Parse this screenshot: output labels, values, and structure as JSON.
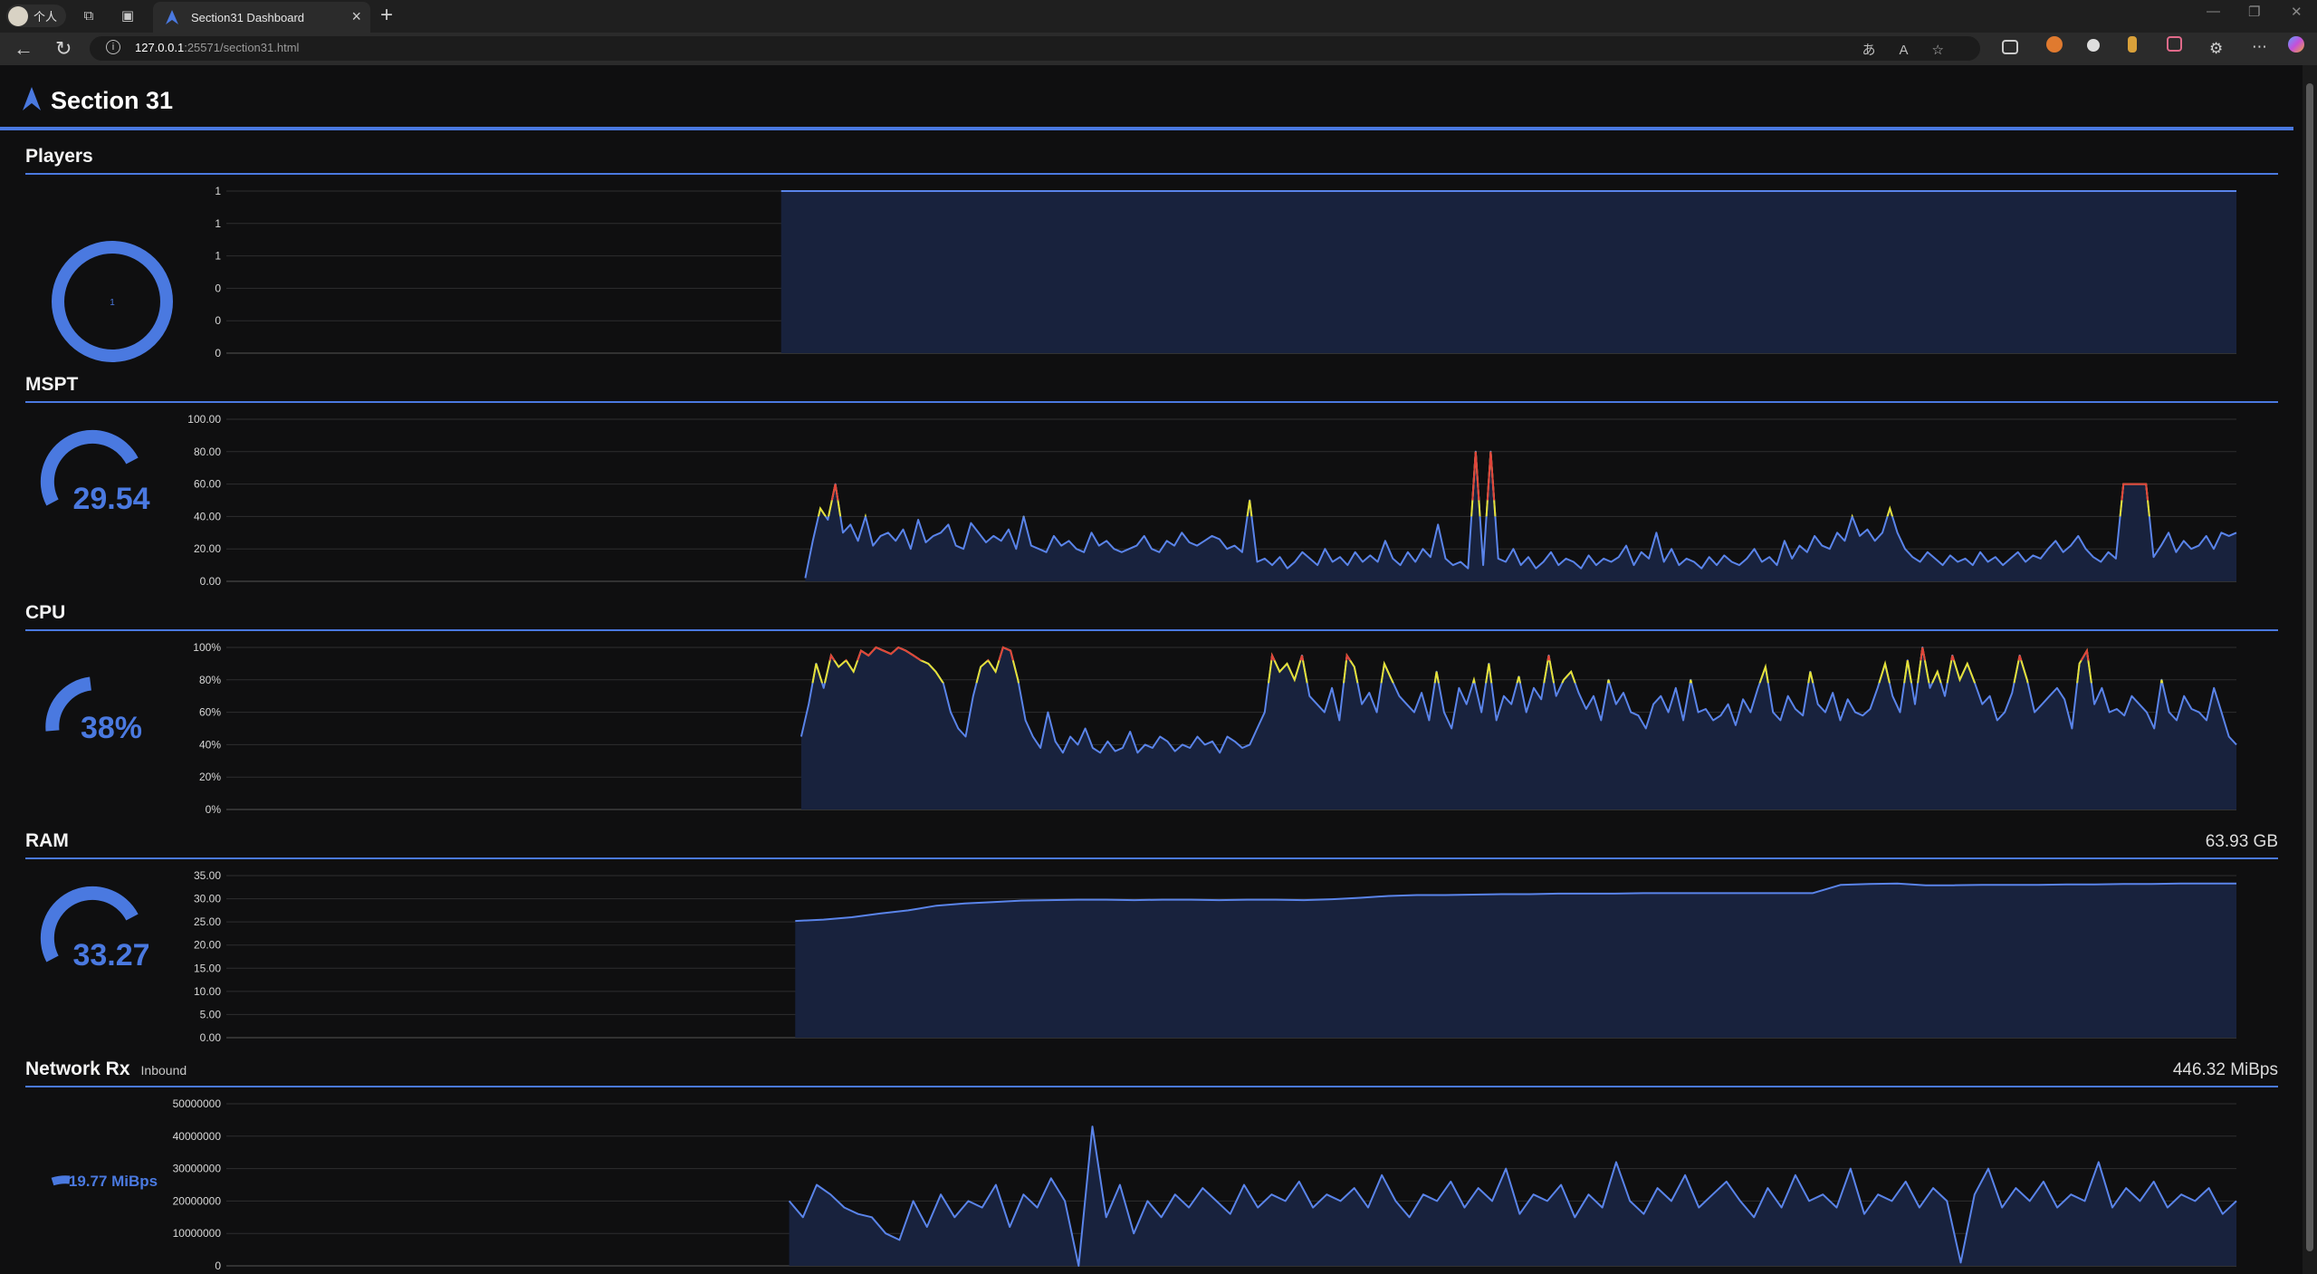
{
  "browser": {
    "profile_label": "个人",
    "tab_title": "Section31 Dashboard",
    "url_host": "127.0.0.1",
    "url_rest": ":25571/section31.html"
  },
  "page": {
    "title": "Section 31"
  },
  "colors": {
    "accent": "#4a79e0",
    "line": "#5a84ea",
    "fill": "#18223d",
    "warn": "#e5e036",
    "crit": "#e0433a"
  },
  "sections": {
    "players": {
      "title": "Players",
      "gauge_value": "1"
    },
    "mspt": {
      "title": "MSPT",
      "gauge_value": "29.54"
    },
    "cpu": {
      "title": "CPU",
      "gauge_value": "38%"
    },
    "ram": {
      "title": "RAM",
      "gauge_value": "33.27",
      "total": "63.93 GB"
    },
    "network": {
      "title": "Network Rx",
      "subtitle": "Inbound",
      "gauge_value": "19.77 MiBps",
      "total": "446.32 MiBps"
    }
  },
  "chart_data": [
    {
      "name": "players",
      "type": "area",
      "yticks": [
        "1",
        "1",
        "1",
        "0",
        "0",
        "0"
      ],
      "ylim": [
        0,
        1
      ],
      "x_start_fraction": 0.276,
      "values": [
        1,
        1,
        1,
        1,
        1,
        1,
        1,
        1,
        1,
        1,
        1,
        1,
        1,
        1,
        1,
        1,
        1,
        1,
        1,
        1
      ]
    },
    {
      "name": "mspt",
      "type": "line",
      "yticks": [
        "100.00",
        "80.00",
        "60.00",
        "40.00",
        "20.00",
        "0.00"
      ],
      "ylim": [
        0,
        100
      ],
      "x_start_fraction": 0.288,
      "warn_threshold": 40,
      "crit_threshold": 50,
      "values": [
        2,
        25,
        45,
        38,
        60,
        30,
        35,
        25,
        40,
        22,
        28,
        30,
        25,
        32,
        20,
        38,
        24,
        28,
        30,
        35,
        22,
        20,
        36,
        30,
        24,
        28,
        25,
        32,
        20,
        40,
        22,
        20,
        18,
        28,
        22,
        25,
        20,
        18,
        30,
        22,
        25,
        20,
        18,
        20,
        22,
        28,
        20,
        18,
        25,
        22,
        30,
        24,
        22,
        25,
        28,
        26,
        20,
        22,
        18,
        50,
        12,
        14,
        10,
        15,
        8,
        12,
        18,
        14,
        10,
        20,
        12,
        15,
        10,
        18,
        12,
        16,
        12,
        25,
        14,
        10,
        18,
        12,
        20,
        15,
        35,
        14,
        10,
        12,
        8,
        80,
        10,
        80,
        14,
        12,
        20,
        10,
        15,
        8,
        12,
        18,
        10,
        14,
        12,
        8,
        16,
        10,
        14,
        12,
        15,
        22,
        10,
        18,
        14,
        30,
        12,
        20,
        10,
        14,
        12,
        8,
        15,
        10,
        16,
        12,
        10,
        14,
        20,
        12,
        15,
        10,
        25,
        14,
        22,
        18,
        28,
        22,
        20,
        30,
        25,
        40,
        28,
        32,
        25,
        30,
        45,
        30,
        20,
        15,
        12,
        18,
        14,
        10,
        16,
        12,
        14,
        10,
        18,
        12,
        15,
        10,
        14,
        18,
        12,
        16,
        14,
        20,
        25,
        18,
        22,
        28,
        20,
        15,
        12,
        18,
        14,
        60,
        60,
        60,
        60,
        15,
        22,
        30,
        18,
        25,
        20,
        22,
        28,
        20,
        30,
        28,
        30
      ]
    },
    {
      "name": "cpu",
      "type": "line",
      "yticks": [
        "100%",
        "80%",
        "60%",
        "40%",
        "20%",
        "0%"
      ],
      "ylim": [
        0,
        100
      ],
      "x_start_fraction": 0.286,
      "warn_threshold": 78,
      "crit_threshold": 92,
      "values": [
        45,
        65,
        90,
        75,
        95,
        88,
        92,
        85,
        98,
        95,
        100,
        98,
        96,
        100,
        98,
        95,
        92,
        90,
        85,
        78,
        60,
        50,
        45,
        70,
        88,
        92,
        85,
        100,
        98,
        80,
        55,
        45,
        38,
        60,
        42,
        35,
        45,
        40,
        50,
        38,
        35,
        42,
        36,
        38,
        48,
        35,
        40,
        38,
        45,
        42,
        36,
        40,
        38,
        45,
        40,
        42,
        35,
        45,
        42,
        38,
        40,
        50,
        60,
        95,
        85,
        90,
        80,
        95,
        70,
        65,
        60,
        75,
        55,
        95,
        88,
        65,
        72,
        60,
        90,
        80,
        70,
        65,
        60,
        72,
        55,
        85,
        60,
        50,
        75,
        65,
        80,
        60,
        90,
        55,
        70,
        65,
        82,
        60,
        75,
        68,
        95,
        70,
        80,
        85,
        72,
        62,
        70,
        55,
        80,
        65,
        72,
        60,
        58,
        50,
        65,
        70,
        60,
        75,
        55,
        80,
        60,
        62,
        55,
        58,
        65,
        52,
        68,
        60,
        75,
        88,
        60,
        55,
        70,
        62,
        58,
        85,
        65,
        60,
        72,
        55,
        68,
        60,
        58,
        62,
        75,
        90,
        70,
        60,
        92,
        65,
        100,
        75,
        85,
        70,
        95,
        80,
        90,
        78,
        65,
        70,
        55,
        60,
        72,
        95,
        80,
        60,
        65,
        70,
        75,
        68,
        50,
        90,
        98,
        65,
        75,
        60,
        62,
        58,
        70,
        65,
        60,
        50,
        80,
        60,
        55,
        70,
        62,
        60,
        55,
        75,
        60,
        45,
        40
      ]
    },
    {
      "name": "ram",
      "type": "line",
      "yticks": [
        "35.00",
        "30.00",
        "25.00",
        "20.00",
        "15.00",
        "10.00",
        "5.00",
        "0.00"
      ],
      "ylim": [
        0,
        35
      ],
      "x_start_fraction": 0.283,
      "values": [
        25.2,
        25.5,
        26,
        26.8,
        27.5,
        28.5,
        29,
        29.3,
        29.6,
        29.7,
        29.8,
        29.8,
        29.7,
        29.8,
        29.8,
        29.7,
        29.8,
        29.8,
        29.7,
        29.9,
        30.2,
        30.6,
        30.8,
        30.8,
        30.9,
        31,
        31,
        31.1,
        31.1,
        31.1,
        31.2,
        31.2,
        31.2,
        31.2,
        31.2,
        31.2,
        31.2,
        33,
        33.2,
        33.3,
        32.9,
        32.9,
        33,
        33,
        33,
        33.1,
        33.1,
        33.2,
        33.2,
        33.3,
        33.3,
        33.3
      ]
    },
    {
      "name": "network_rx",
      "type": "line",
      "yticks": [
        "50000000",
        "40000000",
        "30000000",
        "20000000",
        "10000000",
        "0"
      ],
      "ylim": [
        0,
        50000000
      ],
      "x_start_fraction": 0.28,
      "values": [
        20000000,
        15000000,
        25000000,
        22000000,
        18000000,
        16000000,
        15000000,
        10000000,
        8000000,
        20000000,
        12000000,
        22000000,
        15000000,
        20000000,
        18000000,
        25000000,
        12000000,
        22000000,
        18000000,
        27000000,
        20000000,
        0,
        43000000,
        15000000,
        25000000,
        10000000,
        20000000,
        15000000,
        22000000,
        18000000,
        24000000,
        20000000,
        16000000,
        25000000,
        18000000,
        22000000,
        20000000,
        26000000,
        18000000,
        22000000,
        20000000,
        24000000,
        18000000,
        28000000,
        20000000,
        15000000,
        22000000,
        20000000,
        26000000,
        18000000,
        24000000,
        20000000,
        30000000,
        16000000,
        22000000,
        20000000,
        25000000,
        15000000,
        22000000,
        18000000,
        32000000,
        20000000,
        16000000,
        24000000,
        20000000,
        28000000,
        18000000,
        22000000,
        26000000,
        20000000,
        15000000,
        24000000,
        18000000,
        28000000,
        20000000,
        22000000,
        18000000,
        30000000,
        16000000,
        22000000,
        20000000,
        26000000,
        18000000,
        24000000,
        20000000,
        1000000,
        22000000,
        30000000,
        18000000,
        24000000,
        20000000,
        26000000,
        18000000,
        22000000,
        20000000,
        32000000,
        18000000,
        24000000,
        20000000,
        26000000,
        18000000,
        22000000,
        20000000,
        24000000,
        16000000,
        20000000
      ]
    }
  ]
}
